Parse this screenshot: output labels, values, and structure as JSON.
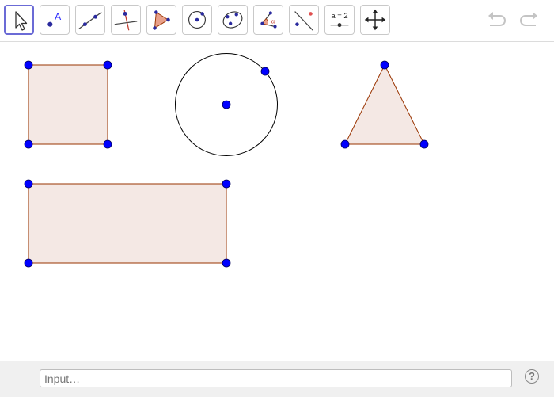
{
  "toolbar": {
    "slider_tool_label": "a = 2",
    "tools": [
      {
        "name": "move",
        "icon": "arrow-cursor-icon",
        "selected": true
      },
      {
        "name": "point",
        "icon": "point-icon"
      },
      {
        "name": "line",
        "icon": "line-icon"
      },
      {
        "name": "perpendicular-line",
        "icon": "perpendicular-line-icon"
      },
      {
        "name": "polygon",
        "icon": "polygon-icon"
      },
      {
        "name": "circle-center-point",
        "icon": "circle-center-point-icon"
      },
      {
        "name": "ellipse",
        "icon": "ellipse-icon"
      },
      {
        "name": "angle",
        "icon": "angle-icon"
      },
      {
        "name": "reflect-about-line",
        "icon": "reflect-icon"
      },
      {
        "name": "slider",
        "icon": "slider-icon"
      },
      {
        "name": "move-graphics-view",
        "icon": "move-graphics-view-icon"
      }
    ],
    "undo_icon": "undo-icon",
    "redo_icon": "redo-icon"
  },
  "colors": {
    "point_fill": "#0000ff",
    "shape_stroke": "#993300",
    "shape_fill": "#f4e8e4",
    "circle_stroke": "#000000",
    "selected_tool_border": "#6b6bd6"
  },
  "input_bar": {
    "placeholder": "Input…",
    "value": "",
    "help_label": "?"
  }
}
